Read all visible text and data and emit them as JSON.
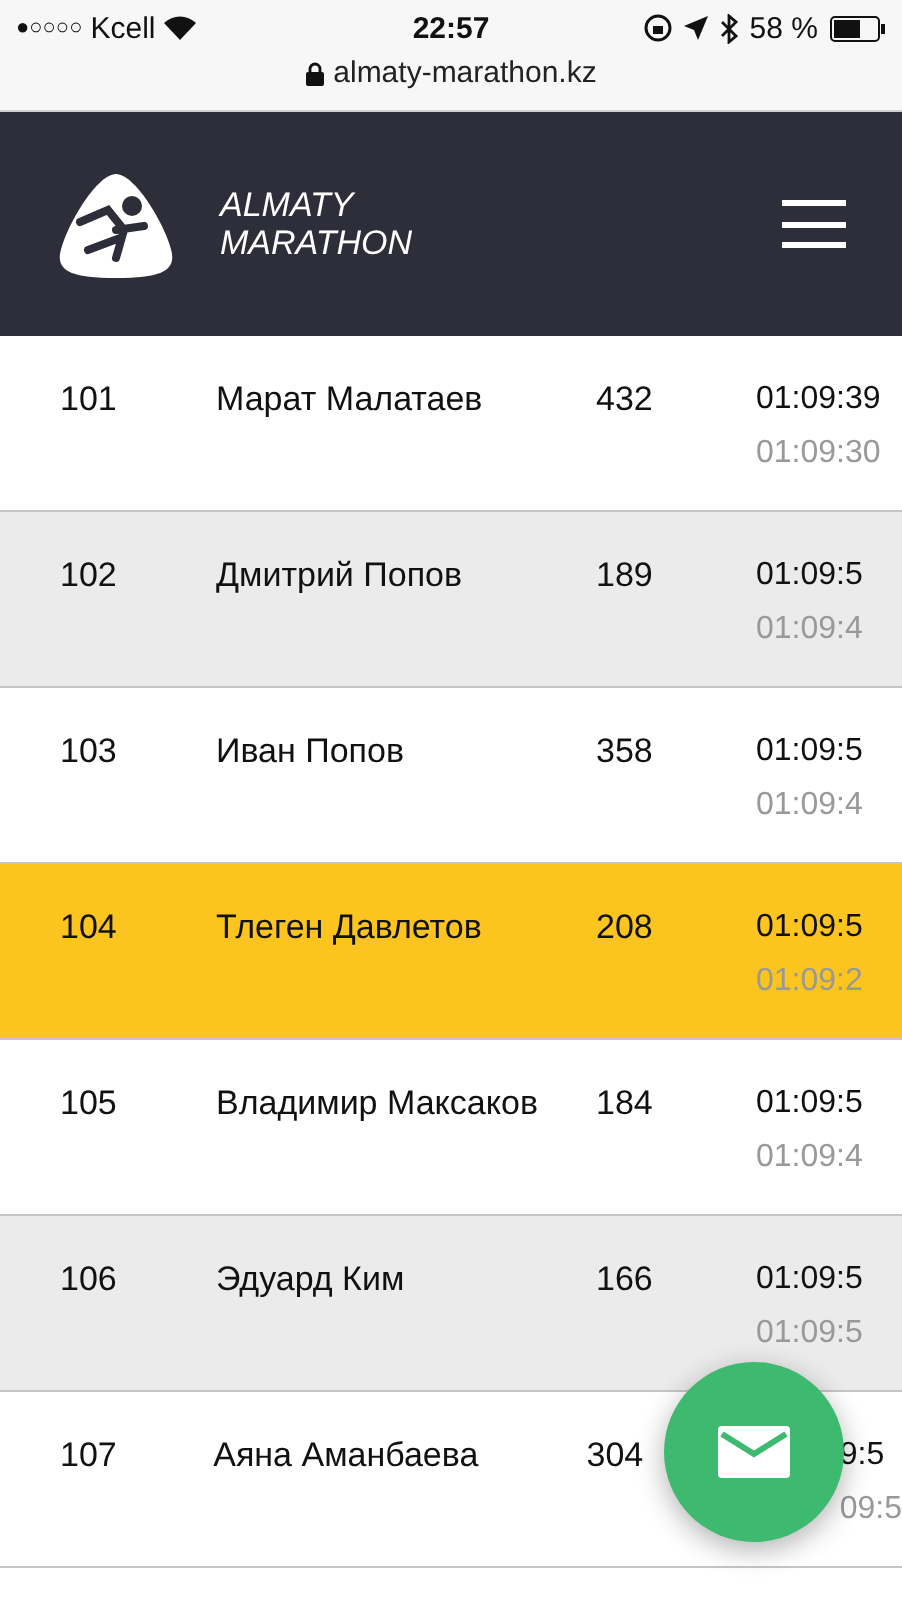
{
  "status_bar": {
    "signal": "●○○○○",
    "carrier": "Kcell",
    "time": "22:57",
    "battery": "58 %"
  },
  "url_bar": {
    "url": "almaty-marathon.kz"
  },
  "header": {
    "logo_line_1": "ALMATY",
    "logo_line_2": "MARATHON"
  },
  "rows": [
    {
      "place": "101",
      "name": "Марат Малатаев",
      "bib": "432",
      "time": "01:09:39",
      "net_time": "01:09:30",
      "selected": false,
      "partly_hidden": false
    },
    {
      "place": "102",
      "name": "Дмитрий Попов",
      "bib": "189",
      "time": "01:09:5",
      "net_time": "01:09:4",
      "selected": false,
      "partly_hidden": false
    },
    {
      "place": "103",
      "name": "Иван Попов",
      "bib": "358",
      "time": "01:09:5",
      "net_time": "01:09:4",
      "selected": false,
      "partly_hidden": false
    },
    {
      "place": "104",
      "name": "Тлеген Давлетов",
      "bib": "208",
      "time": "01:09:5",
      "net_time": "01:09:2",
      "selected": true,
      "partly_hidden": false
    },
    {
      "place": "105",
      "name": "Владимир Максаков",
      "bib": "184",
      "time": "01:09:5",
      "net_time": "01:09:4",
      "selected": false,
      "partly_hidden": false
    },
    {
      "place": "106",
      "name": "Эдуард Ким",
      "bib": "166",
      "time": "01:09:5",
      "net_time": "01:09:5",
      "selected": false,
      "partly_hidden": false
    },
    {
      "place": "107",
      "name": "Аяна Аманбаева",
      "bib": "304",
      "time": "9:5",
      "net_time": "09:5",
      "selected": false,
      "partly_hidden": true
    }
  ]
}
